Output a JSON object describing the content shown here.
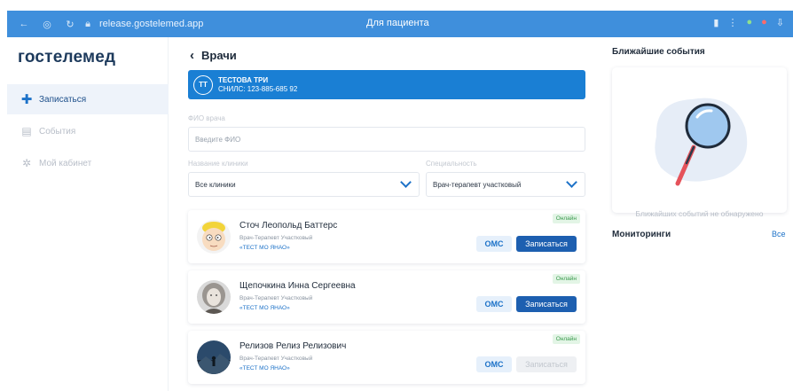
{
  "browser": {
    "url": "release.gostelemed.app",
    "tab_title": "Для пациента"
  },
  "sidebar": {
    "logo": "гостелемед",
    "items": [
      {
        "label": "Записаться",
        "icon": "plus-icon",
        "active": true
      },
      {
        "label": "События",
        "icon": "calendar-icon",
        "active": false
      },
      {
        "label": "Мой кабинет",
        "icon": "gear-icon",
        "active": false
      }
    ]
  },
  "main": {
    "back_label": "Врачи",
    "patient": {
      "initials": "ТТ",
      "name": "ТЕСТОВА ТРИ",
      "snils": "СНИЛС: 123-885-685 92"
    },
    "fio_label": "ФИО врача",
    "fio_placeholder": "Введите ФИО",
    "clinic_label": "Название клиники",
    "clinic_value": "Все клиники",
    "specialty_label": "Специальность",
    "specialty_value": "Врач-терапевт участковый",
    "doctors": [
      {
        "name": "Сточ Леопольд Баттерс",
        "spec": "Врач-Терапевт Участковый",
        "org": "«ТЕСТ МО ЯНАО»",
        "status": "Онлайн",
        "oms": "ОМС",
        "book": "Записаться",
        "book_enabled": true
      },
      {
        "name": "Щепочкина Инна Сергеевна",
        "spec": "Врач-Терапевт Участковый",
        "org": "«ТЕСТ МО ЯНАО»",
        "status": "Онлайн",
        "oms": "ОМС",
        "book": "Записаться",
        "book_enabled": true
      },
      {
        "name": "Релизов Релиз Релизович",
        "spec": "Врач-Терапевт Участковый",
        "org": "«ТЕСТ МО ЯНАО»",
        "status": "Онлайн",
        "oms": "ОМС",
        "book": "Записаться",
        "book_enabled": false
      }
    ]
  },
  "right": {
    "events_title": "Ближайшие события",
    "no_events": "Ближайших событий не обнаружено",
    "monitoring_title": "Мониторинги",
    "monitoring_all": "Все"
  },
  "colors": {
    "primary": "#1d72c8",
    "patient_banner": "#1a7fd4",
    "online_badge": "#3a9a4d",
    "browser_bar": "#3f8fdc"
  }
}
